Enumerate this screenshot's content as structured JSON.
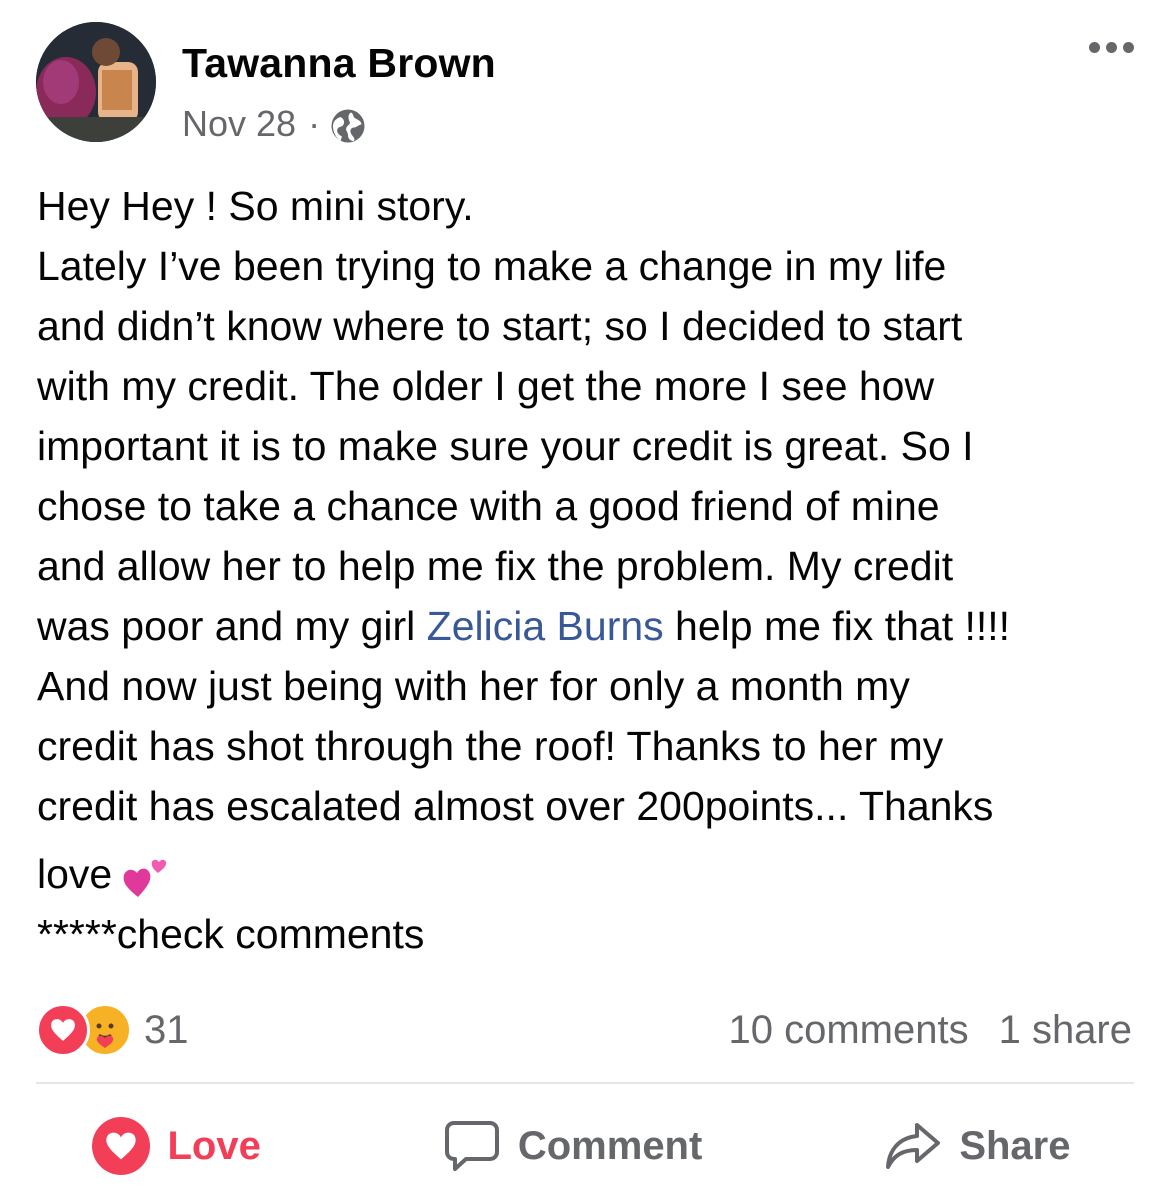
{
  "post": {
    "author": "Tawanna Brown",
    "date": "Nov 28",
    "separator": "·",
    "privacy_icon": "globe-icon",
    "text_lines": [
      "Hey Hey ! So mini story.",
      "Lately I’ve been trying to make a change in my life",
      "and didn’t know where to start; so I decided to start",
      "with my credit. The older I get the more I see how",
      "important it is to make sure your credit is great. So I",
      "chose to take a chance with a good friend of mine",
      "and allow her to help me fix the problem. My credit"
    ],
    "mention_line": {
      "before": "was poor and my girl ",
      "mention": "Zelicia Burns",
      "after": " help me fix that !!!!"
    },
    "text_lines_2": [
      "And now just being with her for only a month my",
      "credit has shot through the roof! Thanks to her my",
      "credit has escalated almost over 200points... Thanks"
    ],
    "love_line": "love",
    "love_emoji": "two-hearts-emoji",
    "footer_line": "*****check comments"
  },
  "stats": {
    "reaction_count": "31",
    "comments": "10 comments",
    "shares": "1 share"
  },
  "actions": {
    "love": "Love",
    "comment": "Comment",
    "share": "Share"
  },
  "colors": {
    "love": "#f33e58",
    "mention": "#385898",
    "secondary_text": "#65676b"
  }
}
